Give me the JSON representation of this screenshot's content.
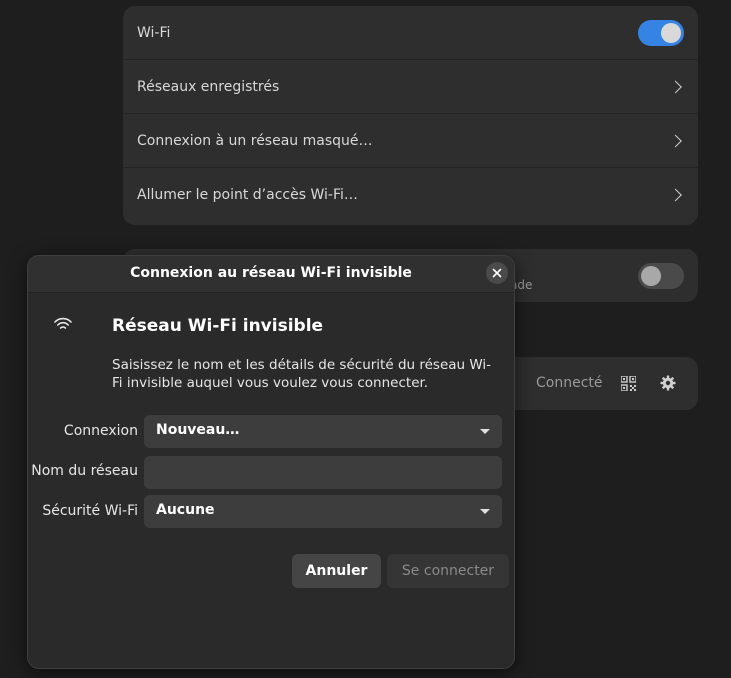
{
  "settings": {
    "wifi_card": {
      "rows": [
        {
          "label": "Wi-Fi"
        },
        {
          "label": "Réseaux enregistrés"
        },
        {
          "label": "Connexion à un réseau masqué…"
        },
        {
          "label": "Allumer le point d’accès Wi-Fi…"
        }
      ],
      "wifi_enabled": true
    },
    "hotspot_card": {
      "partial_text": "ade",
      "enabled": false
    },
    "network_card": {
      "status": "Connecté",
      "icons": [
        "qr-code-icon",
        "gear-icon"
      ]
    }
  },
  "dialog": {
    "title": "Connexion au réseau Wi-Fi invisible",
    "heading": "Réseau Wi-Fi invisible",
    "description": "Saisissez le nom et les détails de sécurité du réseau Wi-Fi invisible auquel vous voulez vous connecter.",
    "icon": "wifi-icon",
    "fields": {
      "connection": {
        "label": "Connexion",
        "value": "Nouveau…"
      },
      "network_name": {
        "label": "Nom du réseau",
        "value": "",
        "placeholder": ""
      },
      "security": {
        "label": "Sécurité Wi-Fi",
        "value": "Aucune"
      }
    },
    "buttons": {
      "cancel": "Annuler",
      "connect": "Se connecter"
    }
  },
  "colors": {
    "accent": "#3584e4",
    "background": "#1e1e1e",
    "card": "#2e2e2e"
  }
}
